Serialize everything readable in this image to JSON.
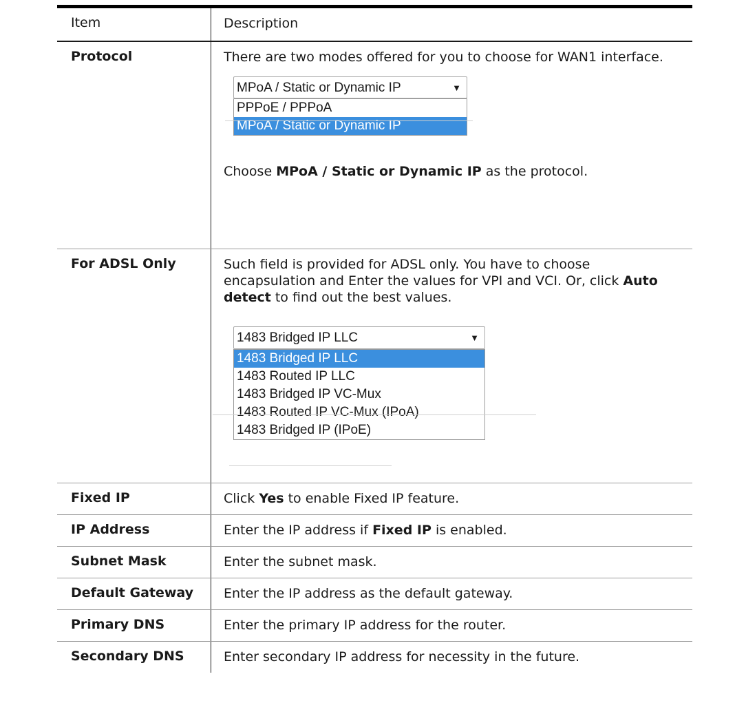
{
  "table": {
    "header": {
      "item": "Item",
      "description": "Description"
    },
    "protocol": {
      "item": "Protocol",
      "desc_line": "There are two modes offered for you to choose for WAN1 interface.",
      "select_value": "MPoA / Static or Dynamic IP",
      "options": [
        "PPPoE / PPPoA",
        "MPoA / Static or Dynamic IP"
      ],
      "choose_prefix": "Choose ",
      "choose_bold": "MPoA / Static or Dynamic IP",
      "choose_suffix": " as the protocol."
    },
    "adsl": {
      "item": "For ADSL Only",
      "desc_part1": "Such field is provided for ADSL only. You have to choose encapsulation and Enter the values for VPI and VCI. Or, click ",
      "desc_bold": "Auto detect",
      "desc_part2": " to find out the best values.",
      "select_value": "1483 Bridged IP LLC",
      "options": [
        "1483 Bridged IP LLC",
        "1483 Routed IP LLC",
        "1483 Bridged IP VC-Mux",
        "1483 Routed IP VC-Mux (IPoA)",
        "1483 Bridged IP (IPoE)"
      ]
    },
    "fixed_ip": {
      "item": "Fixed IP",
      "prefix": "Click ",
      "bold": "Yes",
      "suffix": " to enable Fixed IP feature."
    },
    "ip_address": {
      "item": "IP Address",
      "prefix": "Enter the IP address if ",
      "bold": "Fixed IP",
      "suffix": " is enabled."
    },
    "subnet_mask": {
      "item": "Subnet Mask",
      "desc": "Enter the subnet mask."
    },
    "default_gateway": {
      "item": "Default Gateway",
      "desc": "Enter the IP address as the default gateway."
    },
    "primary_dns": {
      "item": "Primary DNS",
      "desc": "Enter the primary IP address for the router."
    },
    "secondary_dns": {
      "item": "Secondary DNS",
      "desc": "Enter secondary IP address for necessity in the future."
    }
  },
  "icons": {
    "dropdown_arrow": "▼"
  },
  "colors": {
    "highlight": "#3b8fde"
  }
}
